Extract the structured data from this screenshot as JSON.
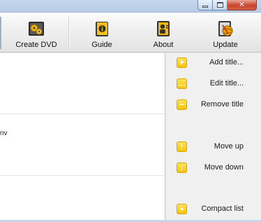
{
  "window": {
    "controls": {
      "minimize": "minimize",
      "maximize": "maximize",
      "close": "close"
    }
  },
  "toolbar": {
    "buttons": [
      {
        "label": "Create DVD",
        "icon": "dvd-gears-icon"
      },
      {
        "label": "Guide",
        "icon": "guide-book-icon"
      },
      {
        "label": "About",
        "icon": "about-info-icon"
      },
      {
        "label": "Update",
        "icon": "update-globe-icon"
      }
    ]
  },
  "list": {
    "rows": [
      {
        "text": "nv"
      }
    ]
  },
  "actions": {
    "items": [
      {
        "label": "Add title...",
        "icon": "plus-icon",
        "glyph": "+"
      },
      {
        "label": "Edit title...",
        "icon": "ellipsis-icon",
        "glyph": "…"
      },
      {
        "label": "Remove title",
        "icon": "minus-icon",
        "glyph": "−"
      },
      {
        "label": "Move up",
        "icon": "arrow-up-icon",
        "glyph": "↑"
      },
      {
        "label": "Move down",
        "icon": "arrow-down-icon",
        "glyph": "↓"
      },
      {
        "label": "Compact list",
        "icon": "compact-list-icon",
        "glyph": "●"
      }
    ]
  },
  "colors": {
    "accent": "#f5c400",
    "close_button": "#c8442f",
    "panel_bg": "#f0f0f0"
  }
}
